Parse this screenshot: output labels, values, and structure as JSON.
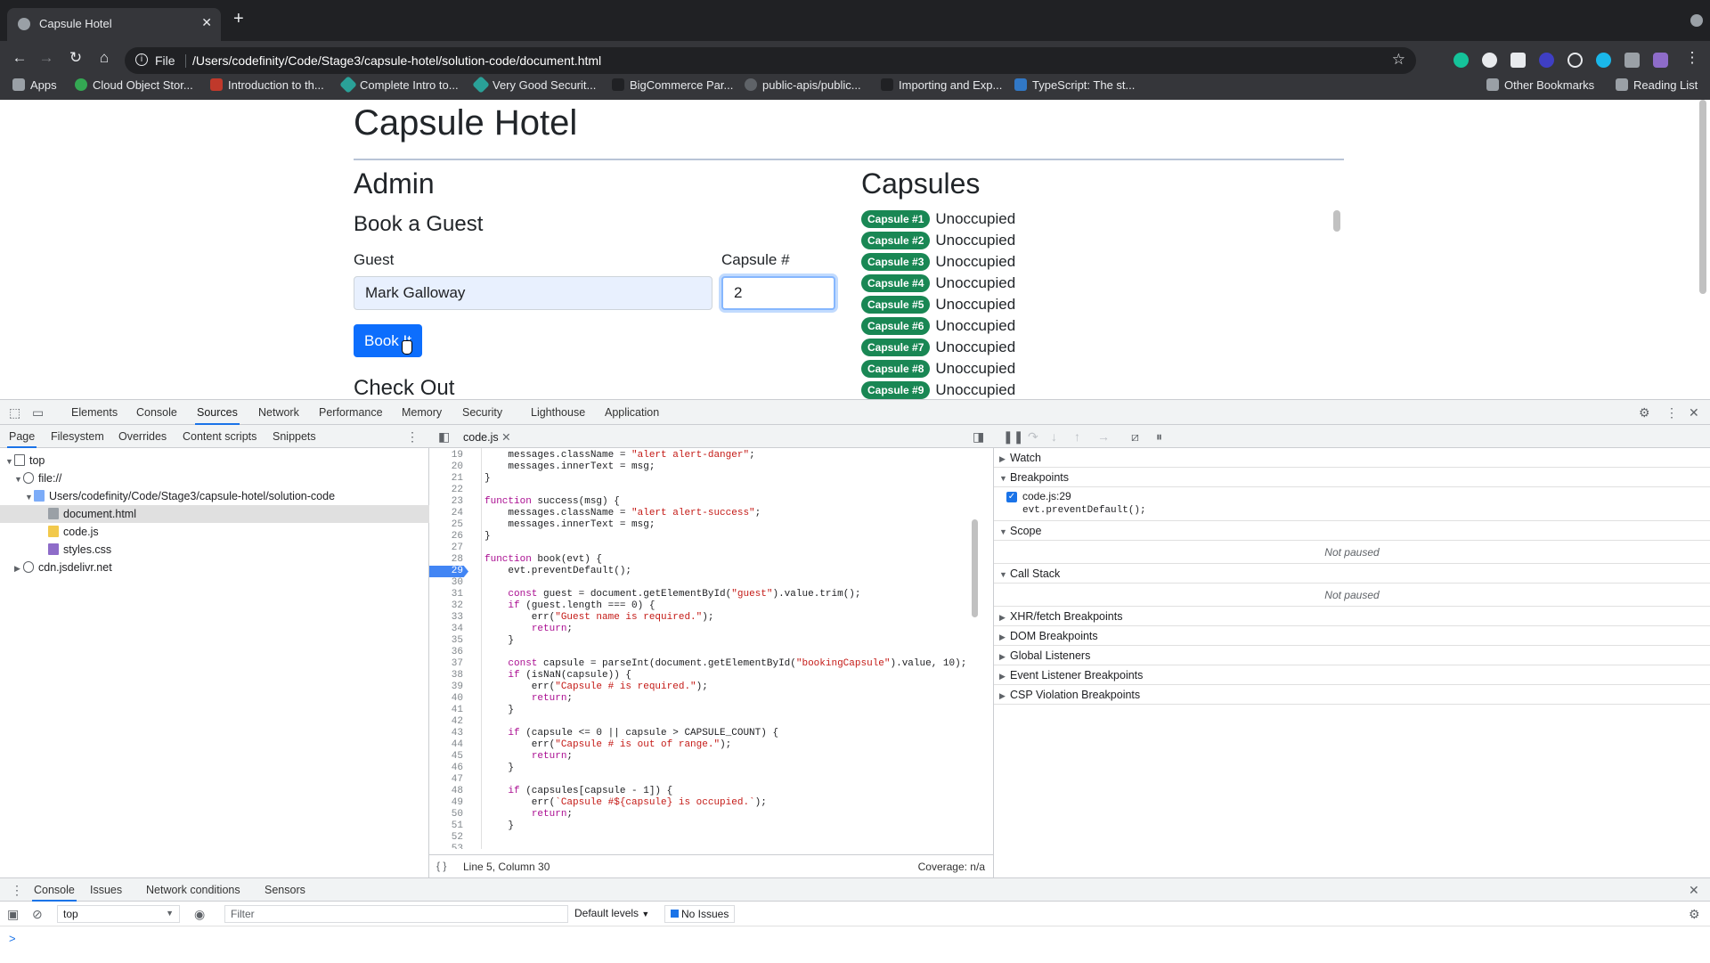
{
  "browser": {
    "tab_title": "Capsule Hotel",
    "url_scheme": "File",
    "url": "/Users/codefinity/Code/Stage3/capsule-hotel/solution-code/document.html",
    "bookmarks": [
      "Apps",
      "Cloud Object Stor...",
      "Introduction to th...",
      "Complete Intro to...",
      "Very Good Securit...",
      "BigCommerce Par...",
      "public-apis/public...",
      "Importing and Exp...",
      "TypeScript: The st..."
    ],
    "other_bookmarks": "Other Bookmarks",
    "reading_list": "Reading List"
  },
  "page": {
    "title": "Capsule Hotel",
    "admin_heading": "Admin",
    "book_heading": "Book a Guest",
    "guest_label": "Guest",
    "guest_value": "Mark Galloway",
    "capsule_label": "Capsule #",
    "capsule_value": "2",
    "book_button": "Book It",
    "checkout_heading": "Check Out",
    "capsules_heading": "Capsules",
    "capsules": [
      {
        "badge": "Capsule #1",
        "status": "Unoccupied"
      },
      {
        "badge": "Capsule #2",
        "status": "Unoccupied"
      },
      {
        "badge": "Capsule #3",
        "status": "Unoccupied"
      },
      {
        "badge": "Capsule #4",
        "status": "Unoccupied"
      },
      {
        "badge": "Capsule #5",
        "status": "Unoccupied"
      },
      {
        "badge": "Capsule #6",
        "status": "Unoccupied"
      },
      {
        "badge": "Capsule #7",
        "status": "Unoccupied"
      },
      {
        "badge": "Capsule #8",
        "status": "Unoccupied"
      },
      {
        "badge": "Capsule #9",
        "status": "Unoccupied"
      }
    ]
  },
  "devtools": {
    "tabs": [
      "Elements",
      "Console",
      "Sources",
      "Network",
      "Performance",
      "Memory",
      "Security",
      "Lighthouse",
      "Application"
    ],
    "nav_tabs": [
      "Page",
      "Filesystem",
      "Overrides",
      "Content scripts",
      "Snippets"
    ],
    "tree": {
      "top": "top",
      "file": "file://",
      "folder": "Users/codefinity/Code/Stage3/capsule-hotel/solution-code",
      "files": [
        "document.html",
        "code.js",
        "styles.css"
      ],
      "cdn": "cdn.jsdelivr.net"
    },
    "editor_tab": "code.js",
    "code_lines": [
      {
        "n": "19",
        "t": "    messages.className = \"alert alert-danger\";"
      },
      {
        "n": "20",
        "t": "    messages.innerText = msg;"
      },
      {
        "n": "21",
        "t": "}"
      },
      {
        "n": "22",
        "t": ""
      },
      {
        "n": "23",
        "t": "function success(msg) {"
      },
      {
        "n": "24",
        "t": "    messages.className = \"alert alert-success\";"
      },
      {
        "n": "25",
        "t": "    messages.innerText = msg;"
      },
      {
        "n": "26",
        "t": "}"
      },
      {
        "n": "27",
        "t": ""
      },
      {
        "n": "28",
        "t": "function book(evt) {"
      },
      {
        "n": "29",
        "t": "    evt.preventDefault();"
      },
      {
        "n": "30",
        "t": ""
      },
      {
        "n": "31",
        "t": "    const guest = document.getElementById(\"guest\").value.trim();"
      },
      {
        "n": "32",
        "t": "    if (guest.length === 0) {"
      },
      {
        "n": "33",
        "t": "        err(\"Guest name is required.\");"
      },
      {
        "n": "34",
        "t": "        return;"
      },
      {
        "n": "35",
        "t": "    }"
      },
      {
        "n": "36",
        "t": ""
      },
      {
        "n": "37",
        "t": "    const capsule = parseInt(document.getElementById(\"bookingCapsule\").value, 10);"
      },
      {
        "n": "38",
        "t": "    if (isNaN(capsule)) {"
      },
      {
        "n": "39",
        "t": "        err(\"Capsule # is required.\");"
      },
      {
        "n": "40",
        "t": "        return;"
      },
      {
        "n": "41",
        "t": "    }"
      },
      {
        "n": "42",
        "t": ""
      },
      {
        "n": "43",
        "t": "    if (capsule <= 0 || capsule > CAPSULE_COUNT) {"
      },
      {
        "n": "44",
        "t": "        err(\"Capsule # is out of range.\");"
      },
      {
        "n": "45",
        "t": "        return;"
      },
      {
        "n": "46",
        "t": "    }"
      },
      {
        "n": "47",
        "t": ""
      },
      {
        "n": "48",
        "t": "    if (capsules[capsule - 1]) {"
      },
      {
        "n": "49",
        "t": "        err(`Capsule #${capsule} is occupied.`);"
      },
      {
        "n": "50",
        "t": "        return;"
      },
      {
        "n": "51",
        "t": "    }"
      },
      {
        "n": "52",
        "t": ""
      },
      {
        "n": "53",
        "t": ""
      }
    ],
    "breakpoint_line": "29",
    "status_position": "Line 5, Column 30",
    "status_coverage": "Coverage: n/a",
    "debug": {
      "watch": "Watch",
      "breakpoints": "Breakpoints",
      "bp_file": "code.js:29",
      "bp_code": "evt.preventDefault();",
      "scope": "Scope",
      "not_paused": "Not paused",
      "call_stack": "Call Stack",
      "sections": [
        "XHR/fetch Breakpoints",
        "DOM Breakpoints",
        "Global Listeners",
        "Event Listener Breakpoints",
        "CSP Violation Breakpoints"
      ]
    },
    "drawer_tabs": [
      "Console",
      "Issues",
      "Network conditions",
      "Sensors"
    ],
    "console": {
      "context": "top",
      "filter_placeholder": "Filter",
      "levels": "Default levels",
      "issues": "No Issues",
      "prompt": ">"
    }
  },
  "colors": {
    "badge_green": "#198754",
    "button_blue": "#0d6efd",
    "breakpoint_blue": "#4285f4",
    "string_red": "#c41a16",
    "keyword_purple": "#aa0d91"
  }
}
